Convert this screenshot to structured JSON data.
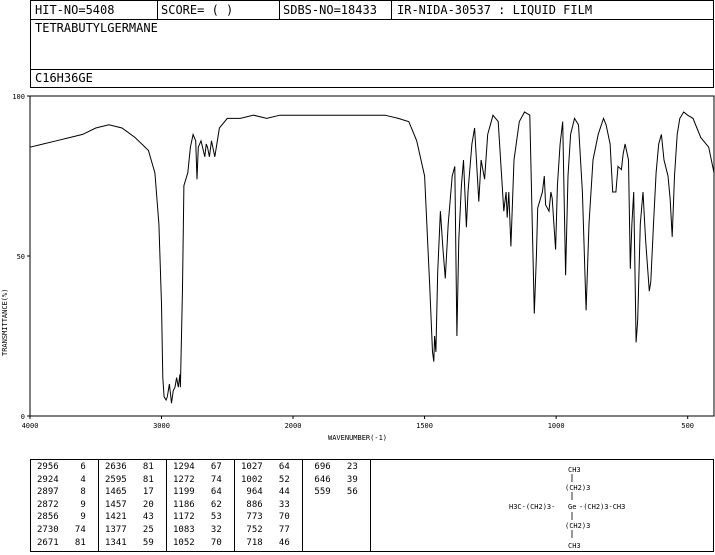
{
  "header": {
    "hit_no": "HIT-NO=5408",
    "score": "SCORE=  (   )",
    "sdbs_no": "SDBS-NO=18433",
    "ir_nida": "IR-NIDA-30537 : LIQUID FILM",
    "compound": "TETRABUTYLGERMANE",
    "formula": "C16H36GE"
  },
  "chart_data": {
    "type": "line",
    "xlabel": "WAVENUMBER(-1)",
    "ylabel": "TRANSMITTANCE(%)",
    "xlim": [
      4000,
      400
    ],
    "ylim": [
      0,
      100
    ],
    "x_ticks": [
      "4000",
      "3000",
      "2000",
      "1500",
      "1000",
      "500"
    ],
    "y_ticks": [
      "0",
      "50",
      "100"
    ],
    "grid": false,
    "series": [
      {
        "points": [
          [
            4000,
            84
          ],
          [
            3900,
            85
          ],
          [
            3800,
            86
          ],
          [
            3700,
            87
          ],
          [
            3600,
            88
          ],
          [
            3500,
            90
          ],
          [
            3400,
            91
          ],
          [
            3300,
            90
          ],
          [
            3200,
            87
          ],
          [
            3100,
            83
          ],
          [
            3050,
            76
          ],
          [
            3020,
            60
          ],
          [
            3000,
            35
          ],
          [
            2990,
            12
          ],
          [
            2980,
            6
          ],
          [
            2965,
            5
          ],
          [
            2956,
            6
          ],
          [
            2940,
            10
          ],
          [
            2924,
            4
          ],
          [
            2910,
            8
          ],
          [
            2897,
            9
          ],
          [
            2885,
            12
          ],
          [
            2872,
            9
          ],
          [
            2860,
            13
          ],
          [
            2856,
            9
          ],
          [
            2840,
            40
          ],
          [
            2830,
            72
          ],
          [
            2800,
            76
          ],
          [
            2780,
            84
          ],
          [
            2760,
            88
          ],
          [
            2740,
            86
          ],
          [
            2730,
            74
          ],
          [
            2720,
            84
          ],
          [
            2700,
            86
          ],
          [
            2671,
            81
          ],
          [
            2660,
            85
          ],
          [
            2650,
            84
          ],
          [
            2636,
            81
          ],
          [
            2620,
            86
          ],
          [
            2595,
            81
          ],
          [
            2560,
            90
          ],
          [
            2500,
            93
          ],
          [
            2400,
            93
          ],
          [
            2300,
            94
          ],
          [
            2200,
            93
          ],
          [
            2100,
            94
          ],
          [
            2000,
            94
          ],
          [
            1900,
            94
          ],
          [
            1800,
            94
          ],
          [
            1700,
            94
          ],
          [
            1650,
            94
          ],
          [
            1600,
            93
          ],
          [
            1560,
            92
          ],
          [
            1530,
            86
          ],
          [
            1500,
            75
          ],
          [
            1480,
            40
          ],
          [
            1470,
            20
          ],
          [
            1465,
            17
          ],
          [
            1462,
            25
          ],
          [
            1457,
            20
          ],
          [
            1450,
            45
          ],
          [
            1440,
            64
          ],
          [
            1430,
            52
          ],
          [
            1421,
            43
          ],
          [
            1410,
            60
          ],
          [
            1395,
            75
          ],
          [
            1385,
            78
          ],
          [
            1377,
            25
          ],
          [
            1370,
            55
          ],
          [
            1360,
            72
          ],
          [
            1352,
            80
          ],
          [
            1341,
            59
          ],
          [
            1335,
            70
          ],
          [
            1320,
            85
          ],
          [
            1310,
            90
          ],
          [
            1294,
            67
          ],
          [
            1285,
            80
          ],
          [
            1272,
            74
          ],
          [
            1260,
            88
          ],
          [
            1240,
            94
          ],
          [
            1220,
            92
          ],
          [
            1199,
            64
          ],
          [
            1190,
            70
          ],
          [
            1186,
            62
          ],
          [
            1180,
            70
          ],
          [
            1172,
            53
          ],
          [
            1160,
            80
          ],
          [
            1140,
            92
          ],
          [
            1120,
            95
          ],
          [
            1100,
            94
          ],
          [
            1083,
            32
          ],
          [
            1075,
            50
          ],
          [
            1070,
            65
          ],
          [
            1052,
            70
          ],
          [
            1045,
            75
          ],
          [
            1040,
            66
          ],
          [
            1027,
            64
          ],
          [
            1020,
            70
          ],
          [
            1015,
            68
          ],
          [
            1002,
            52
          ],
          [
            995,
            72
          ],
          [
            985,
            85
          ],
          [
            975,
            92
          ],
          [
            964,
            44
          ],
          [
            955,
            75
          ],
          [
            945,
            88
          ],
          [
            930,
            93
          ],
          [
            915,
            91
          ],
          [
            900,
            70
          ],
          [
            886,
            33
          ],
          [
            875,
            60
          ],
          [
            860,
            80
          ],
          [
            840,
            88
          ],
          [
            820,
            93
          ],
          [
            810,
            91
          ],
          [
            795,
            85
          ],
          [
            785,
            70
          ],
          [
            773,
            70
          ],
          [
            765,
            78
          ],
          [
            752,
            77
          ],
          [
            745,
            82
          ],
          [
            738,
            85
          ],
          [
            725,
            80
          ],
          [
            718,
            46
          ],
          [
            712,
            60
          ],
          [
            705,
            70
          ],
          [
            696,
            23
          ],
          [
            690,
            30
          ],
          [
            680,
            60
          ],
          [
            670,
            70
          ],
          [
            660,
            55
          ],
          [
            646,
            39
          ],
          [
            640,
            42
          ],
          [
            630,
            60
          ],
          [
            620,
            76
          ],
          [
            610,
            85
          ],
          [
            600,
            88
          ],
          [
            590,
            80
          ],
          [
            575,
            75
          ],
          [
            567,
            68
          ],
          [
            559,
            56
          ],
          [
            550,
            75
          ],
          [
            540,
            88
          ],
          [
            530,
            93
          ],
          [
            515,
            95
          ],
          [
            500,
            94
          ],
          [
            480,
            93
          ],
          [
            465,
            90
          ],
          [
            450,
            87
          ],
          [
            420,
            84
          ],
          [
            400,
            76
          ]
        ]
      }
    ],
    "peak_table": [
      [
        2956,
        6
      ],
      [
        2924,
        4
      ],
      [
        2897,
        8
      ],
      [
        2872,
        9
      ],
      [
        2856,
        9
      ],
      [
        2730,
        74
      ],
      [
        2671,
        81
      ],
      [
        2636,
        81
      ],
      [
        2595,
        81
      ],
      [
        1465,
        17
      ],
      [
        1457,
        20
      ],
      [
        1421,
        43
      ],
      [
        1377,
        25
      ],
      [
        1341,
        59
      ],
      [
        1294,
        67
      ],
      [
        1272,
        74
      ],
      [
        1199,
        64
      ],
      [
        1186,
        62
      ],
      [
        1172,
        53
      ],
      [
        1083,
        32
      ],
      [
        1052,
        70
      ],
      [
        1027,
        64
      ],
      [
        1002,
        52
      ],
      [
        964,
        44
      ],
      [
        886,
        33
      ],
      [
        773,
        70
      ],
      [
        752,
        77
      ],
      [
        718,
        46
      ],
      [
        696,
        23
      ],
      [
        646,
        39
      ],
      [
        559,
        56
      ]
    ]
  },
  "structure": {
    "top": "CH3",
    "top_chain": "(CH2)3",
    "left": "H3C-(CH2)3-",
    "center": "Ge",
    "right": "-(CH2)3-CH3",
    "bottom_chain": "(CH2)3",
    "bottom": "CH3"
  }
}
